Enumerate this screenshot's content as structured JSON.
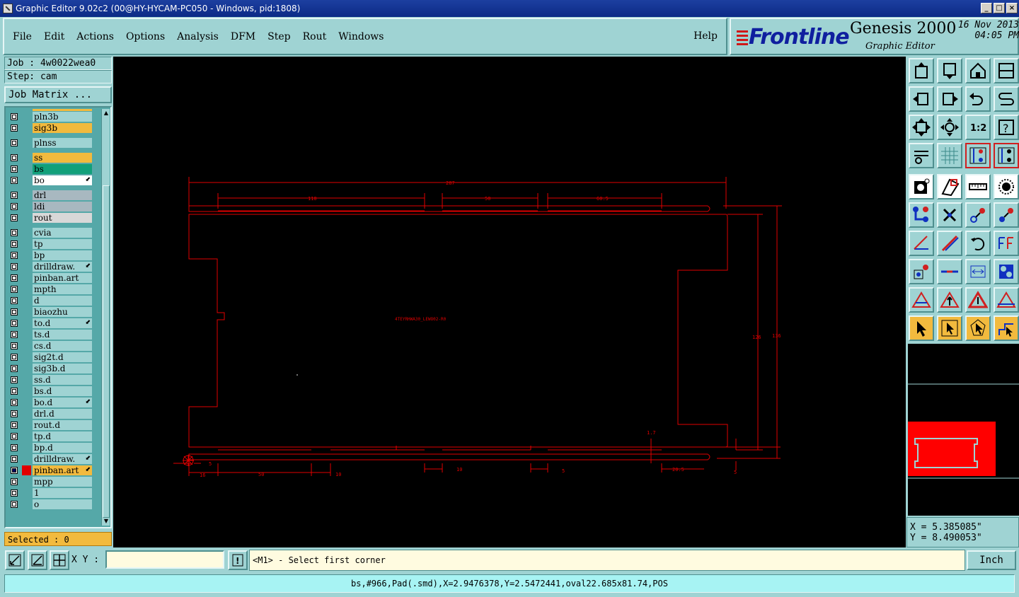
{
  "window": {
    "title": "Graphic Editor 9.02c2 (00@HY-HYCAM-PC050 - Windows, pid:1808)",
    "buttons": [
      "_",
      "□",
      "×"
    ]
  },
  "menu": {
    "items": [
      "File",
      "Edit",
      "Actions",
      "Options",
      "Analysis",
      "DFM",
      "Step",
      "Rout",
      "Windows"
    ],
    "help": "Help"
  },
  "brand": {
    "logo": "Frontline",
    "product": "Genesis 2000",
    "subtitle": "Graphic Editor",
    "date": "16 Nov 2013",
    "time": "04:05 PM"
  },
  "job": {
    "job_label": "Job : 4w0022wea0",
    "step_label": "Step: cam",
    "matrix_button": "Job Matrix ..."
  },
  "layers": [
    {
      "name": "pln3b",
      "color": "#9fd3d3"
    },
    {
      "name": "sig3b",
      "color": "#f2ba3e"
    },
    {
      "gap": true
    },
    {
      "name": "plnss",
      "color": "#9fd3d3"
    },
    {
      "gap": true
    },
    {
      "name": "ss",
      "color": "#f2ba3e"
    },
    {
      "name": "bs",
      "color": "#12a07a"
    },
    {
      "name": "bo",
      "color": "#ffffff",
      "mark": "⬋"
    },
    {
      "gap": true
    },
    {
      "name": "drl",
      "color": "#a8b8c0"
    },
    {
      "name": "ldi",
      "color": "#a8b8c0"
    },
    {
      "name": "rout",
      "color": "#d8d8d8"
    },
    {
      "gap": true
    },
    {
      "name": "cvia",
      "color": "#9fd3d3"
    },
    {
      "name": "tp",
      "color": "#9fd3d3"
    },
    {
      "name": "bp",
      "color": "#9fd3d3"
    },
    {
      "name": "drilldraw.",
      "color": "#9fd3d3",
      "mark": "⬋"
    },
    {
      "name": "pinban.art",
      "color": "#9fd3d3"
    },
    {
      "name": "mpth",
      "color": "#9fd3d3"
    },
    {
      "name": "d",
      "color": "#9fd3d3"
    },
    {
      "name": "biaozhu",
      "color": "#9fd3d3"
    },
    {
      "name": "to.d",
      "color": "#9fd3d3",
      "mark": "⬋"
    },
    {
      "name": "ts.d",
      "color": "#9fd3d3"
    },
    {
      "name": "cs.d",
      "color": "#9fd3d3"
    },
    {
      "name": "sig2t.d",
      "color": "#9fd3d3"
    },
    {
      "name": "sig3b.d",
      "color": "#9fd3d3"
    },
    {
      "name": "ss.d",
      "color": "#9fd3d3"
    },
    {
      "name": "bs.d",
      "color": "#9fd3d3"
    },
    {
      "name": "bo.d",
      "color": "#9fd3d3",
      "mark": "⬋"
    },
    {
      "name": "drl.d",
      "color": "#9fd3d3"
    },
    {
      "name": "rout.d",
      "color": "#9fd3d3"
    },
    {
      "name": "tp.d",
      "color": "#9fd3d3"
    },
    {
      "name": "bp.d",
      "color": "#9fd3d3"
    },
    {
      "name": "drilldraw.",
      "color": "#9fd3d3",
      "mark": "⬋"
    },
    {
      "name": "pinban.art",
      "color": "#f2ba3e",
      "checked": true,
      "swatch": "#e00000",
      "mark": "⬋"
    },
    {
      "name": "mpp",
      "color": "#9fd3d3"
    },
    {
      "name": "1",
      "color": "#9fd3d3"
    },
    {
      "name": "o",
      "color": "#9fd3d3"
    }
  ],
  "selected": "Selected : 0",
  "drawing": {
    "dim_total": "287",
    "dim_a": "110",
    "dim_b": "50",
    "dim_c": "60.5",
    "dim_h1": "126",
    "dim_h2": "136",
    "dim_bottom1": "16",
    "dim_bottom2": "50",
    "dim_bottom3": "10",
    "dim_bottom4": "10",
    "dim_bottom5": "5",
    "dim_bottom6": "20.5",
    "dim_v1": "1.7",
    "dim_v2": "5",
    "dim_small": "5",
    "part_text": "4TEYRHWA30_LEWO02-R0"
  },
  "coords": {
    "x": "X = 5.385085\"",
    "y": "Y = 8.490053\""
  },
  "bottom": {
    "xy_label": "X Y :",
    "xy_value": "",
    "prompt": "<M1> - Select first corner",
    "unit": "Inch",
    "status": "bs,#966,Pad(.smd),X=2.9476378,Y=2.5472441,oval22.685x81.74,POS"
  },
  "colors": {
    "accent": "#9fd3d3",
    "highlight": "#f2ba3e",
    "draw": "#e00000",
    "overview_fill": "#ff0000"
  }
}
